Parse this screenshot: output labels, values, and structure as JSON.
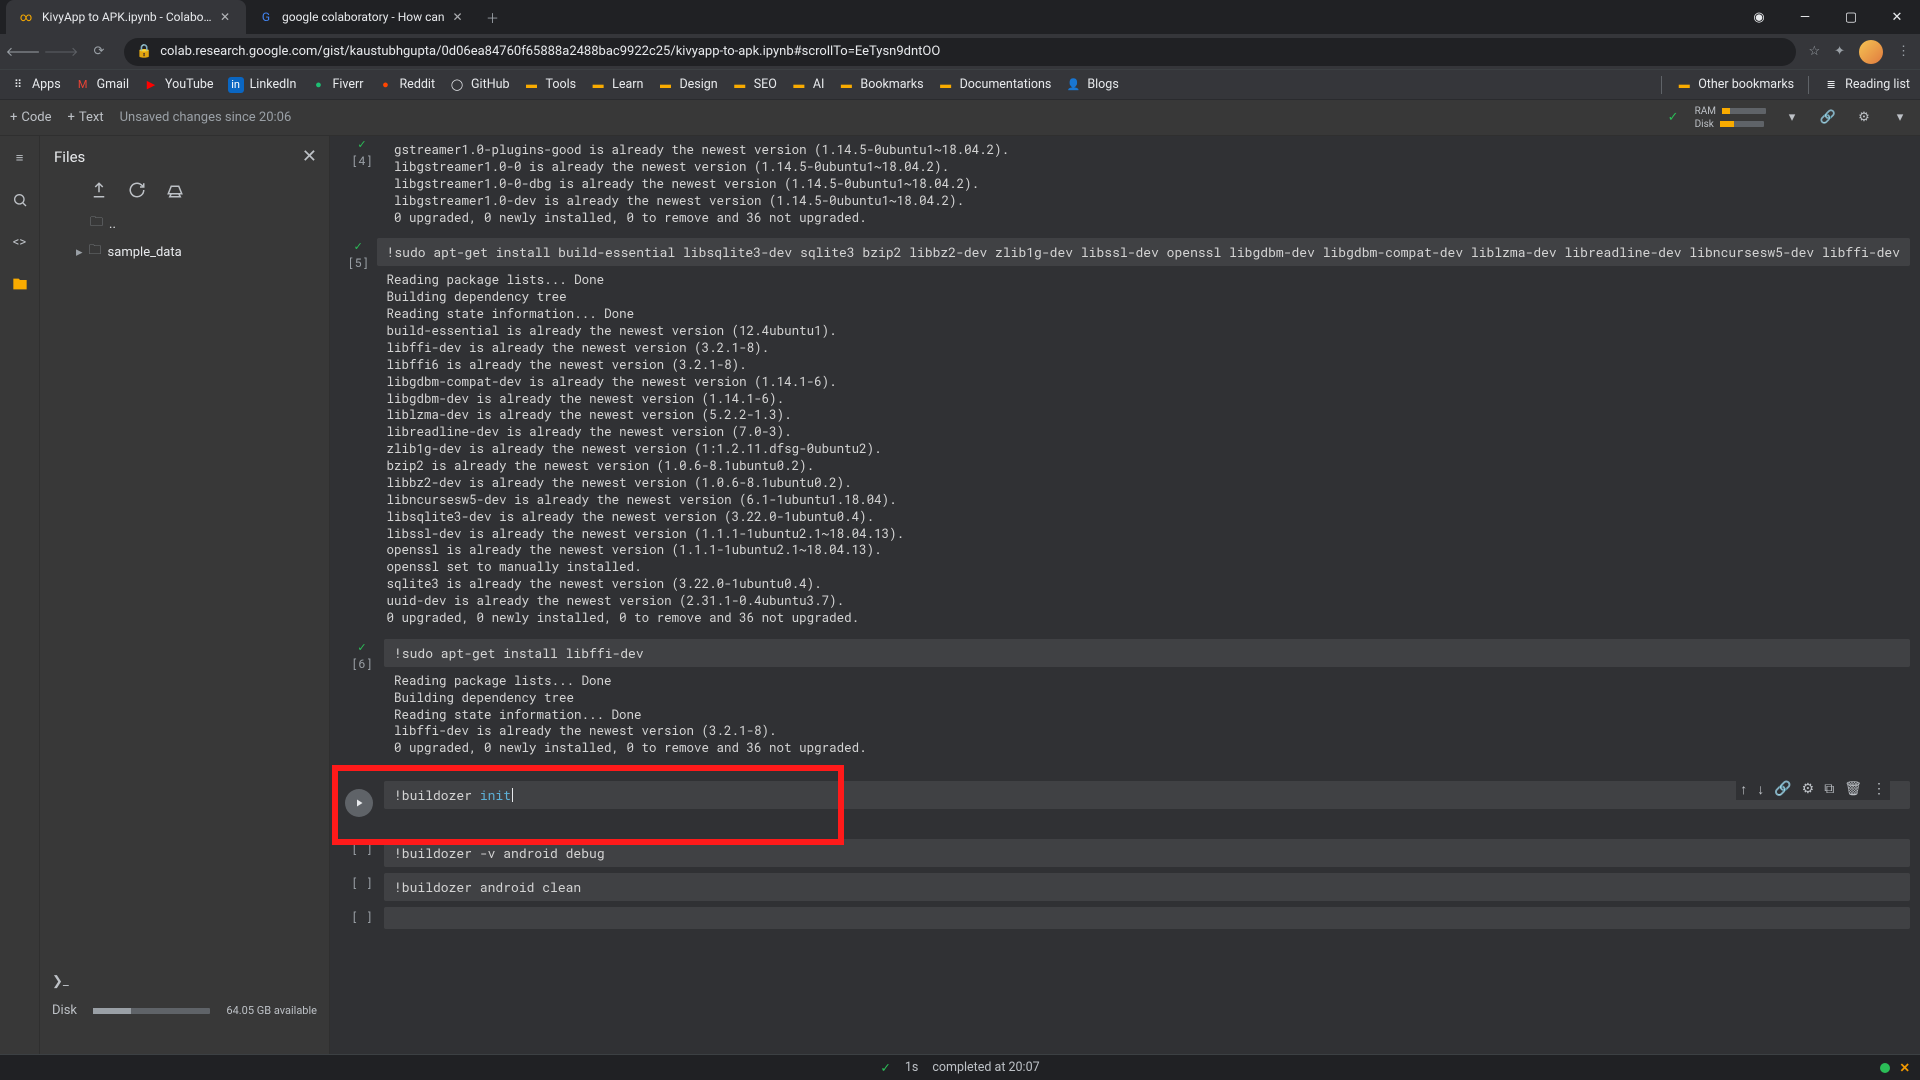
{
  "browser": {
    "tabs": [
      {
        "title": "KivyApp to APK.ipynb - Colabora",
        "active": true
      },
      {
        "title": "google colaboratory - How can",
        "active": false
      }
    ],
    "url": "colab.research.google.com/gist/kaustubhgupta/0d06ea84760f65888a2488bac9922c25/kivyapp-to-apk.ipynb#scrollTo=EeTysn9dntOO",
    "bookmarks_left": [
      "Apps",
      "Gmail",
      "YouTube",
      "LinkedIn",
      "Fiverr",
      "Reddit",
      "GitHub",
      "Tools",
      "Learn",
      "Design",
      "SEO",
      "AI",
      "Bookmarks",
      "Documentations",
      "Blogs"
    ],
    "bookmarks_right": [
      "Other bookmarks",
      "Reading list"
    ]
  },
  "toolbar": {
    "code_btn": "Code",
    "text_btn": "Text",
    "status": "Unsaved changes since 20:06",
    "ram_label": "RAM",
    "disk_label": "Disk"
  },
  "files_panel": {
    "title": "Files",
    "nodes": [
      "..",
      "sample_data"
    ],
    "disk_label": "Disk",
    "disk_avail": "64.05 GB available"
  },
  "cells": {
    "c4": {
      "num": "[4]",
      "output": "gstreamer1.0-plugins-good is already the newest version (1.14.5-0ubuntu1~18.04.2).\nlibgstreamer1.0-0 is already the newest version (1.14.5-0ubuntu1~18.04.2).\nlibgstreamer1.0-0-dbg is already the newest version (1.14.5-0ubuntu1~18.04.2).\nlibgstreamer1.0-dev is already the newest version (1.14.5-0ubuntu1~18.04.2).\n0 upgraded, 0 newly installed, 0 to remove and 36 not upgraded."
    },
    "c5": {
      "num": "[5]",
      "code": "!sudo apt-get install build-essential libsqlite3-dev sqlite3 bzip2 libbz2-dev zlib1g-dev libssl-dev openssl libgdbm-dev libgdbm-compat-dev liblzma-dev libreadline-dev libncursesw5-dev libffi-dev",
      "output": "Reading package lists... Done\nBuilding dependency tree       \nReading state information... Done\nbuild-essential is already the newest version (12.4ubuntu1).\nlibffi-dev is already the newest version (3.2.1-8).\nlibffi6 is already the newest version (3.2.1-8).\nlibgdbm-compat-dev is already the newest version (1.14.1-6).\nlibgdbm-dev is already the newest version (1.14.1-6).\nliblzma-dev is already the newest version (5.2.2-1.3).\nlibreadline-dev is already the newest version (7.0-3).\nzlib1g-dev is already the newest version (1:1.2.11.dfsg-0ubuntu2).\nbzip2 is already the newest version (1.0.6-8.1ubuntu0.2).\nlibbz2-dev is already the newest version (1.0.6-8.1ubuntu0.2).\nlibncursesw5-dev is already the newest version (6.1-1ubuntu1.18.04).\nlibsqlite3-dev is already the newest version (3.22.0-1ubuntu0.4).\nlibssl-dev is already the newest version (1.1.1-1ubuntu2.1~18.04.13).\nopenssl is already the newest version (1.1.1-1ubuntu2.1~18.04.13).\nopenssl set to manually installed.\nsqlite3 is already the newest version (3.22.0-1ubuntu0.4).\nuuid-dev is already the newest version (2.31.1-0.4ubuntu3.7).\n0 upgraded, 0 newly installed, 0 to remove and 36 not upgraded."
    },
    "c6": {
      "num": "[6]",
      "code": "!sudo apt-get install libffi-dev",
      "output": "Reading package lists... Done\nBuilding dependency tree       \nReading state information... Done\nlibffi-dev is already the newest version (3.2.1-8).\n0 upgraded, 0 newly installed, 0 to remove and 36 not upgraded."
    },
    "c7": {
      "num": "[ ]",
      "code_prefix": "!buildozer ",
      "code_kw": "init"
    },
    "c8": {
      "num": "[ ]",
      "code": "!buildozer -v android debug"
    },
    "c9": {
      "num": "[ ]",
      "code": "!buildozer android clean"
    },
    "c10": {
      "num": "[ ]",
      "code": ""
    }
  },
  "statusbar": {
    "time": "1s",
    "msg": "completed at 20:07"
  }
}
